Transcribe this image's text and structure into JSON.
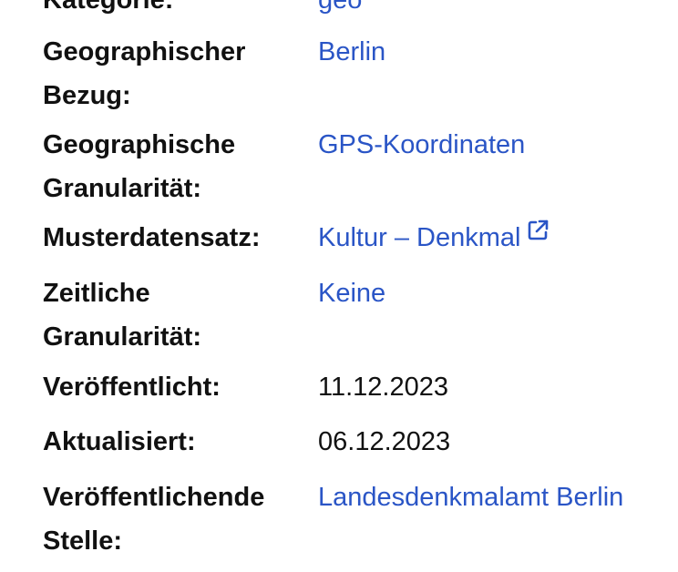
{
  "rows": [
    {
      "label": "Kategorie:",
      "value": "geo"
    },
    {
      "label": "Geographischer Bezug:",
      "value": "Berlin"
    },
    {
      "label": "Geographische Granularität:",
      "value": "GPS-Koordinaten"
    },
    {
      "label": "Musterdatensatz:",
      "value": "Kultur – Denkmal",
      "icon": "external-link-icon"
    },
    {
      "label": "Zeitliche Granularität:",
      "value": "Keine"
    },
    {
      "label": "Veröffentlicht:",
      "value": "11.12.2023"
    },
    {
      "label": "Aktualisiert:",
      "value": "06.12.2023"
    },
    {
      "label": "Veröffentlichende Stelle:",
      "value": "Landesdenkmalamt Berlin"
    }
  ],
  "colors": {
    "link": "#2a55c6",
    "text": "#111111",
    "background": "#ffffff"
  }
}
